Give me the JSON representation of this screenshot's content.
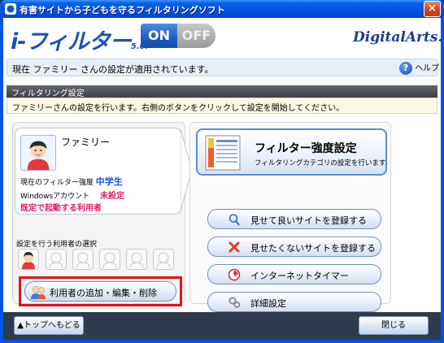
{
  "window": {
    "title": "有害サイトから子どもを守るフィルタリングソフト",
    "close_label": "×"
  },
  "header": {
    "logo_text": "i-フィルター",
    "logo_version": "5.0.",
    "toggle_on_label": "ON",
    "toggle_off_label": "OFF",
    "brand": "DigitalArts."
  },
  "status": {
    "message": "現在 ファミリー さんの設定が適用されています。",
    "help_label": "ヘルプ",
    "help_glyph": "?"
  },
  "section": {
    "title": "フィルタリング設定",
    "notice": "ファミリーさんの設定を行います。右側のボタンをクリックして設定を開始してください。"
  },
  "profile": {
    "name": "ファミリー",
    "strength_label": "現在のフィルター強度",
    "strength_value": "中学生",
    "windows_label": "Windowsアカウント",
    "windows_value": "未設定",
    "default_user_label": "既定で起動する利用者"
  },
  "user_select": {
    "label": "設定を行う利用者の選択",
    "slot_count": 6
  },
  "manage_button": {
    "label": "利用者の追加・編集・削除"
  },
  "filter_strength": {
    "title": "フィルター強度設定",
    "subtitle": "フィルタリングカテゴリの設定を行います"
  },
  "actions": [
    {
      "label": "見せて良いサイトを登録する",
      "icon": "magnifier-icon"
    },
    {
      "label": "見せたくないサイトを登録する",
      "icon": "x-icon"
    },
    {
      "label": "インターネットタイマー",
      "icon": "timer-icon"
    },
    {
      "label": "詳細設定",
      "icon": "gears-icon"
    }
  ],
  "footer": {
    "back_label": "▲トップへもどる",
    "close_label": "閉じる"
  },
  "colors": {
    "accent_blue": "#1a56e0",
    "accent_pink": "#e0206b",
    "highlight_red": "#e1121a"
  }
}
